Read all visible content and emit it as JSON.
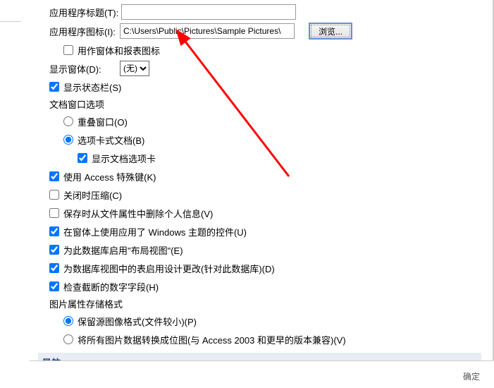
{
  "fields": {
    "app_title_label": "应用程序标题(T):",
    "app_title_value": "",
    "app_icon_label": "应用程序图标(I):",
    "app_icon_value": "C:\\Users\\Public\\Pictures\\Sample Pictures\\",
    "browse_label": "浏览...",
    "use_form_report_icon": "用作窗体和报表图标",
    "display_form_label": "显示窗体(D):",
    "display_form_value": "(无)"
  },
  "options": {
    "show_statusbar": "显示状态栏(S)",
    "doc_window_section": "文档窗口选项",
    "overlapping_windows": "重叠窗口(O)",
    "tabbed_documents": "选项卡式文档(B)",
    "show_doc_tabs": "显示文档选项卡",
    "use_access_special_keys": "使用 Access 特殊键(K)",
    "compact_on_close": "关闭时压缩(C)",
    "remove_personal_info": "保存时从文件属性中删除个人信息(V)",
    "windows_themed_controls": "在窗体上使用应用了 Windows 主题的控件(U)",
    "enable_layout_view": "为此数据库启用\"布局视图\"(E)",
    "enable_design_changes": "为数据库视图中的表启用设计更改(针对此数据库)(D)",
    "check_truncated_numbers": "检查截断的数字字段(H)",
    "pic_storage_section": "图片属性存储格式",
    "preserve_source_format": "保留源图像格式(文件较小)(P)",
    "convert_to_bitmap": "将所有图片数据转换成位图(与 Access 2003 和更早的版本兼容)(V)"
  },
  "nav_label": "导航",
  "footer_ok": "确定"
}
